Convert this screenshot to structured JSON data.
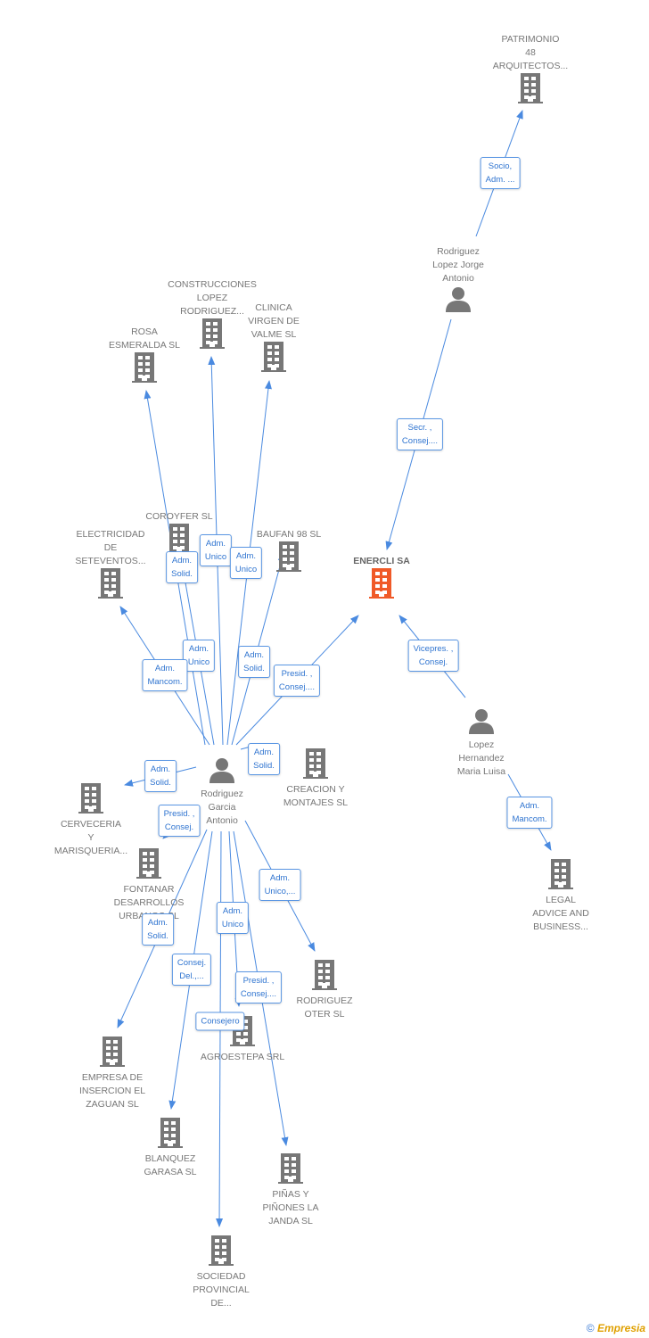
{
  "colors": {
    "edge": "#4a8ae0",
    "node": "#777777",
    "focus": "#f05a28"
  },
  "nodes": [
    {
      "id": "patrimonio",
      "type": "company",
      "label": "PATRIMONIO\n48\nARQUITECTOS..."
    },
    {
      "id": "jorge",
      "type": "person",
      "label": "Rodriguez\nLopez Jorge\nAntonio"
    },
    {
      "id": "enercli",
      "type": "company",
      "label": "ENERCLI SA",
      "focus": true
    },
    {
      "id": "maria",
      "type": "person",
      "label": "Lopez\nHernandez\nMaria Luisa"
    },
    {
      "id": "legal",
      "type": "company",
      "label": "LEGAL\nADVICE AND\nBUSINESS..."
    },
    {
      "id": "rosa",
      "type": "company",
      "label": "ROSA\nESMERALDA SL"
    },
    {
      "id": "construcciones",
      "type": "company",
      "label": "CONSTRUCCIONES\nLOPEZ\nRODRIGUEZ..."
    },
    {
      "id": "clinica",
      "type": "company",
      "label": "CLINICA\nVIRGEN DE\nVALME SL"
    },
    {
      "id": "coroyfer",
      "type": "company",
      "label": "COROYFER SL"
    },
    {
      "id": "electricidad",
      "type": "company",
      "label": "ELECTRICIDAD\nDE\nSETEVENTOS..."
    },
    {
      "id": "baufan",
      "type": "company",
      "label": "BAUFAN 98 SL"
    },
    {
      "id": "rga",
      "type": "person",
      "label": "Rodriguez\nGarcia\nAntonio"
    },
    {
      "id": "creacion",
      "type": "company",
      "label": "CREACION Y\nMONTAJES SL"
    },
    {
      "id": "cerveceria",
      "type": "company",
      "label": "CERVECERIA\nY\nMARISQUERIA..."
    },
    {
      "id": "fontanar",
      "type": "company",
      "label": "FONTANAR\nDESARROLLOS\nURBANOS SL"
    },
    {
      "id": "oter",
      "type": "company",
      "label": "RODRIGUEZ\nOTER SL"
    },
    {
      "id": "agroestepa",
      "type": "company",
      "label": "AGROESTEPA SRL"
    },
    {
      "id": "empresa",
      "type": "company",
      "label": "EMPRESA DE\nINSERCION EL\nZAGUAN SL"
    },
    {
      "id": "blanquez",
      "type": "company",
      "label": "BLANQUEZ\nGARASA SL"
    },
    {
      "id": "pinas",
      "type": "company",
      "label": "PIÑAS Y\nPIÑONES LA\nJANDA SL"
    },
    {
      "id": "sociedad",
      "type": "company",
      "label": "SOCIEDAD\nPROVINCIAL\nDE..."
    }
  ],
  "edges": [
    {
      "from": "jorge",
      "to": "patrimonio",
      "role": "Socio,\nAdm. ..."
    },
    {
      "from": "jorge",
      "to": "enercli",
      "role": "Secr. ,\nConsej...."
    },
    {
      "from": "maria",
      "to": "enercli",
      "role": "Vicepres. ,\nConsej."
    },
    {
      "from": "maria",
      "to": "legal",
      "role": "Adm.\nMancom."
    },
    {
      "from": "rga",
      "to": "rosa",
      "role": "Adm.\nSolid."
    },
    {
      "from": "rga",
      "to": "construcciones",
      "role": "Adm.\nUnico"
    },
    {
      "from": "rga",
      "to": "clinica",
      "role": "Adm.\nUnico"
    },
    {
      "from": "rga",
      "to": "coroyfer",
      "role": "Adm.\nUnico"
    },
    {
      "from": "rga",
      "to": "electricidad",
      "role": "Adm.\nMancom."
    },
    {
      "from": "rga",
      "to": "baufan",
      "role": "Adm.\nSolid."
    },
    {
      "from": "rga",
      "to": "enercli",
      "role": "Presid. ,\nConsej...."
    },
    {
      "from": "rga",
      "to": "creacion",
      "role": "Adm.\nSolid."
    },
    {
      "from": "rga",
      "to": "cerveceria",
      "role": "Adm.\nSolid."
    },
    {
      "from": "rga",
      "to": "fontanar",
      "role": "Presid. ,\nConsej."
    },
    {
      "from": "rga",
      "to": "empresa",
      "role": "Adm.\nSolid."
    },
    {
      "from": "rga",
      "to": "blanquez",
      "role": "Consej.\nDel.,..."
    },
    {
      "from": "rga",
      "to": "oter",
      "role": "Adm.\nUnico,..."
    },
    {
      "from": "rga",
      "to": "agroestepa",
      "role": "Adm.\nUnico"
    },
    {
      "from": "rga",
      "to": "pinas",
      "role": "Presid. ,\nConsej...."
    },
    {
      "from": "rga",
      "to": "sociedad",
      "role": "Consejero"
    }
  ],
  "watermark": {
    "symbol": "©",
    "brand": "Empresia"
  }
}
